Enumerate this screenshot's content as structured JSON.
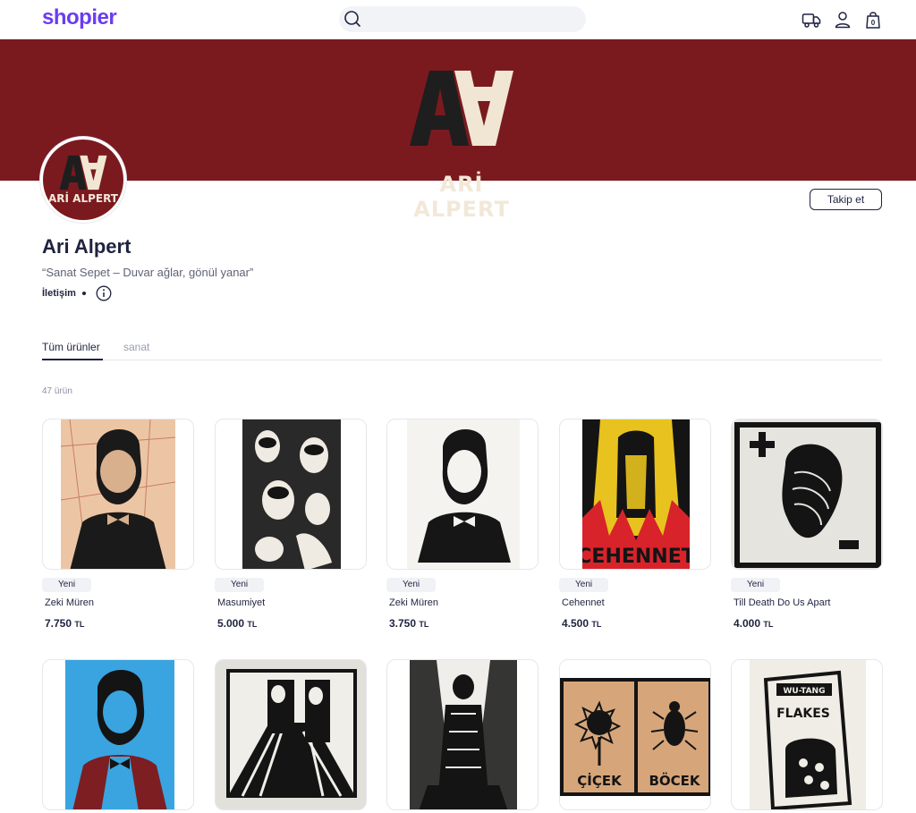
{
  "header": {
    "logo": "shopier",
    "search_placeholder": "",
    "icons": [
      "search-icon",
      "truck-icon",
      "user-icon",
      "bag-icon"
    ],
    "cart_count": "0"
  },
  "banner": {
    "logo_letters": "AA",
    "logo_name": "ARİ ALPERT",
    "background": "#7a1a1f"
  },
  "store": {
    "name": "Ari Alpert",
    "description": "“Sanat Sepet – Duvar ağlar, gönül yanar”",
    "contact_label": "İletişim",
    "follow_label": "Takip et"
  },
  "tabs": [
    {
      "label": "Tüm ürünler",
      "active": true
    },
    {
      "label": "sanat",
      "active": false
    }
  ],
  "product_count": "47 ürün",
  "products": [
    {
      "badge": "Yeni",
      "name": "Zeki Müren",
      "price": "7.750",
      "currency": "TL"
    },
    {
      "badge": "Yeni",
      "name": "Masumiyet",
      "price": "5.000",
      "currency": "TL"
    },
    {
      "badge": "Yeni",
      "name": "Zeki Müren",
      "price": "3.750",
      "currency": "TL"
    },
    {
      "badge": "Yeni",
      "name": "Cehennet",
      "price": "4.500",
      "currency": "TL"
    },
    {
      "badge": "Yeni",
      "name": "Till Death Do Us Apart",
      "price": "4.000",
      "currency": "TL"
    }
  ],
  "artwork_text": {
    "cehennet": "CEHENNET",
    "cicek": "ÇİÇEK",
    "bocek": "BÖCEK",
    "flakes": "FLAKES",
    "wutang": "WU-TANG"
  },
  "colors": {
    "brand": "#6b3cf2",
    "banner": "#7a1a1f",
    "text": "#1f2340"
  }
}
